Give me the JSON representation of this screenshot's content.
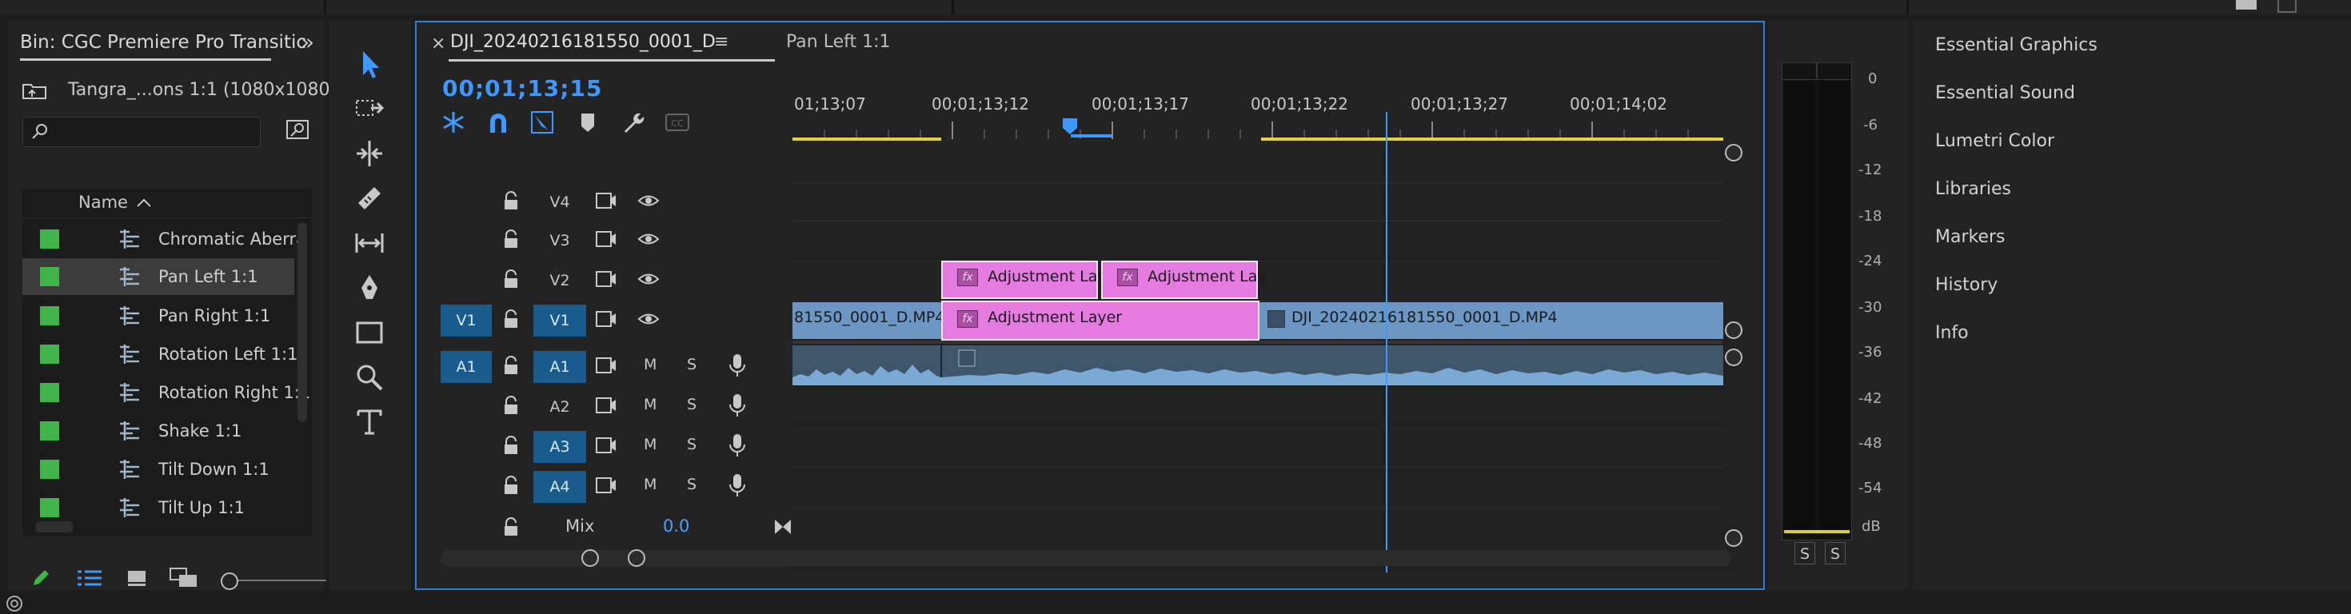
{
  "project": {
    "tab_title": "Bin: CGC Premiere Pro Transitic",
    "bin_path": "Tangra_...ons 1:1 (1080x1080)",
    "column_name": "Name",
    "items": [
      {
        "label": "Chromatic Aberra"
      },
      {
        "label": "Pan Left 1:1",
        "selected": true
      },
      {
        "label": "Pan Right 1:1"
      },
      {
        "label": "Rotation Left 1:1"
      },
      {
        "label": "Rotation Right 1:1"
      },
      {
        "label": "Shake 1:1"
      },
      {
        "label": "Tilt Down 1:1"
      },
      {
        "label": "Tilt Up 1:1"
      }
    ],
    "swatch_color": "#3fb449"
  },
  "timeline": {
    "sequence_tab": "DJI_20240216181550_0001_D",
    "close_glyph": "×",
    "menu_glyph": "≡",
    "second_tab": "Pan Left 1:1",
    "timecode": "00;01;13;15",
    "ruler_labels": [
      "01;13;07",
      "00;01;13;12",
      "00;01;13;17",
      "00;01;13;22",
      "00;01;13;27",
      "00;01;14;02"
    ],
    "video_tracks": [
      {
        "label": "V4"
      },
      {
        "label": "V3"
      },
      {
        "label": "V2"
      },
      {
        "label": "V1",
        "source": "V1"
      }
    ],
    "audio_tracks": [
      {
        "label": "A1",
        "source": "A1",
        "m": "M",
        "s": "S"
      },
      {
        "label": "A2",
        "m": "M",
        "s": "S"
      },
      {
        "label": "A3",
        "m": "M",
        "s": "S"
      },
      {
        "label": "A4",
        "m": "M",
        "s": "S"
      }
    ],
    "mix_label": "Mix",
    "mix_value": "0.0",
    "clips": {
      "v2_a": "Adjustment Lay",
      "v2_b": "Adjustment Lay",
      "v1_left": "81550_0001_D.MP4",
      "v1_adj": "Adjustment Layer",
      "v1_right": "DJI_20240216181550_0001_D.MP4",
      "fx": "fx"
    },
    "accent": "#3f98ff"
  },
  "meter": {
    "labels": [
      "0",
      "-6",
      "-12",
      "-18",
      "-24",
      "-30",
      "-36",
      "-42",
      "-48",
      "-54",
      "dB"
    ],
    "solo": [
      "S",
      "S"
    ]
  },
  "right_panel": {
    "items": [
      "Essential Graphics",
      "Essential Sound",
      "Lumetri Color",
      "Libraries",
      "Markers",
      "History",
      "Info"
    ]
  }
}
